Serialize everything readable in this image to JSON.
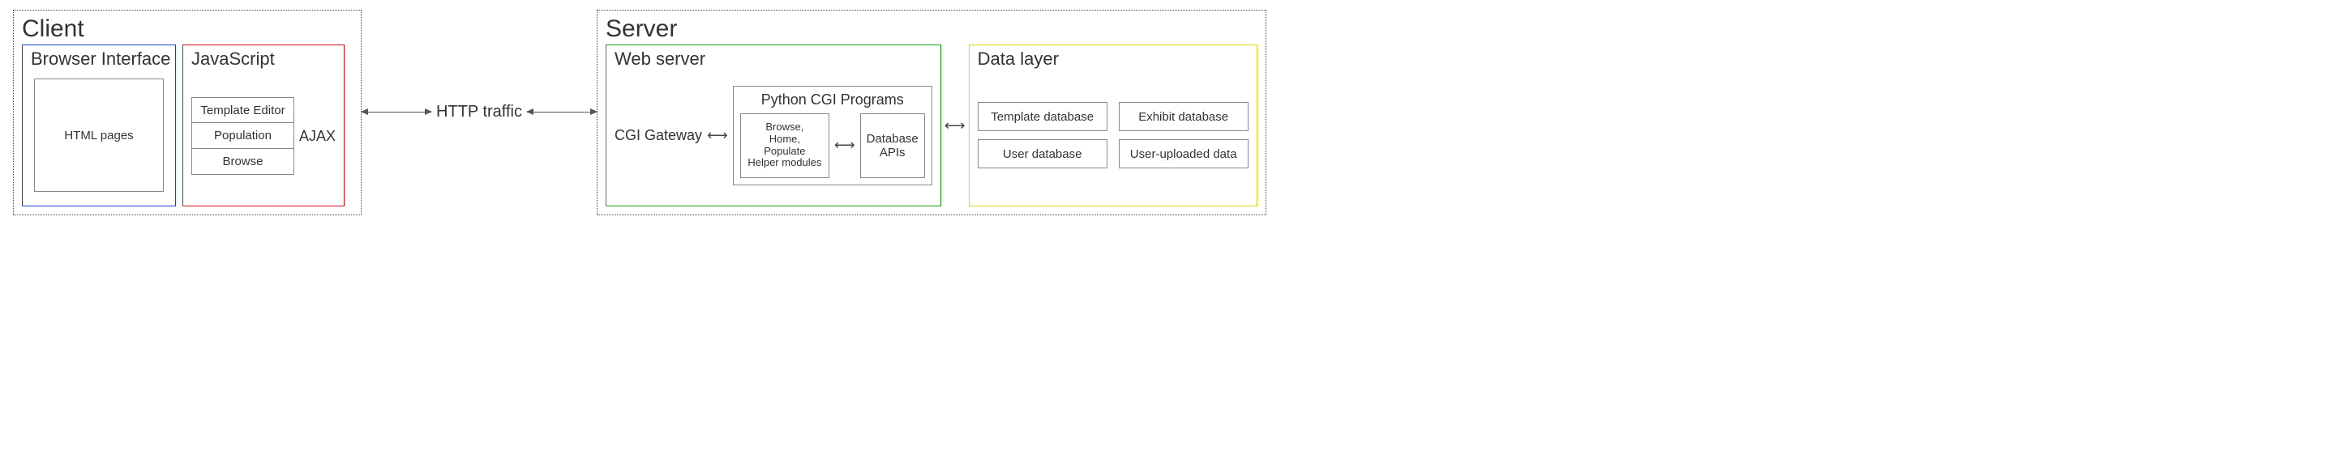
{
  "client": {
    "title": "Client",
    "browser": {
      "title": "Browser Interface",
      "page": "HTML pages"
    },
    "js": {
      "title": "JavaScript",
      "items": [
        "Template Editor",
        "Population",
        "Browse"
      ],
      "ajax": "AJAX"
    }
  },
  "link": {
    "label": "HTTP traffic"
  },
  "server": {
    "title": "Server",
    "web": {
      "title": "Web server",
      "gateway": "CGI Gateway",
      "cgi": {
        "title": "Python CGI Programs",
        "modules": "Browse,\nHome,\nPopulate\nHelper modules",
        "apis": "Database\nAPIs"
      }
    },
    "data": {
      "title": "Data layer",
      "items": [
        "Template database",
        "Exhibit database",
        "User database",
        "User-uploaded data"
      ]
    }
  }
}
